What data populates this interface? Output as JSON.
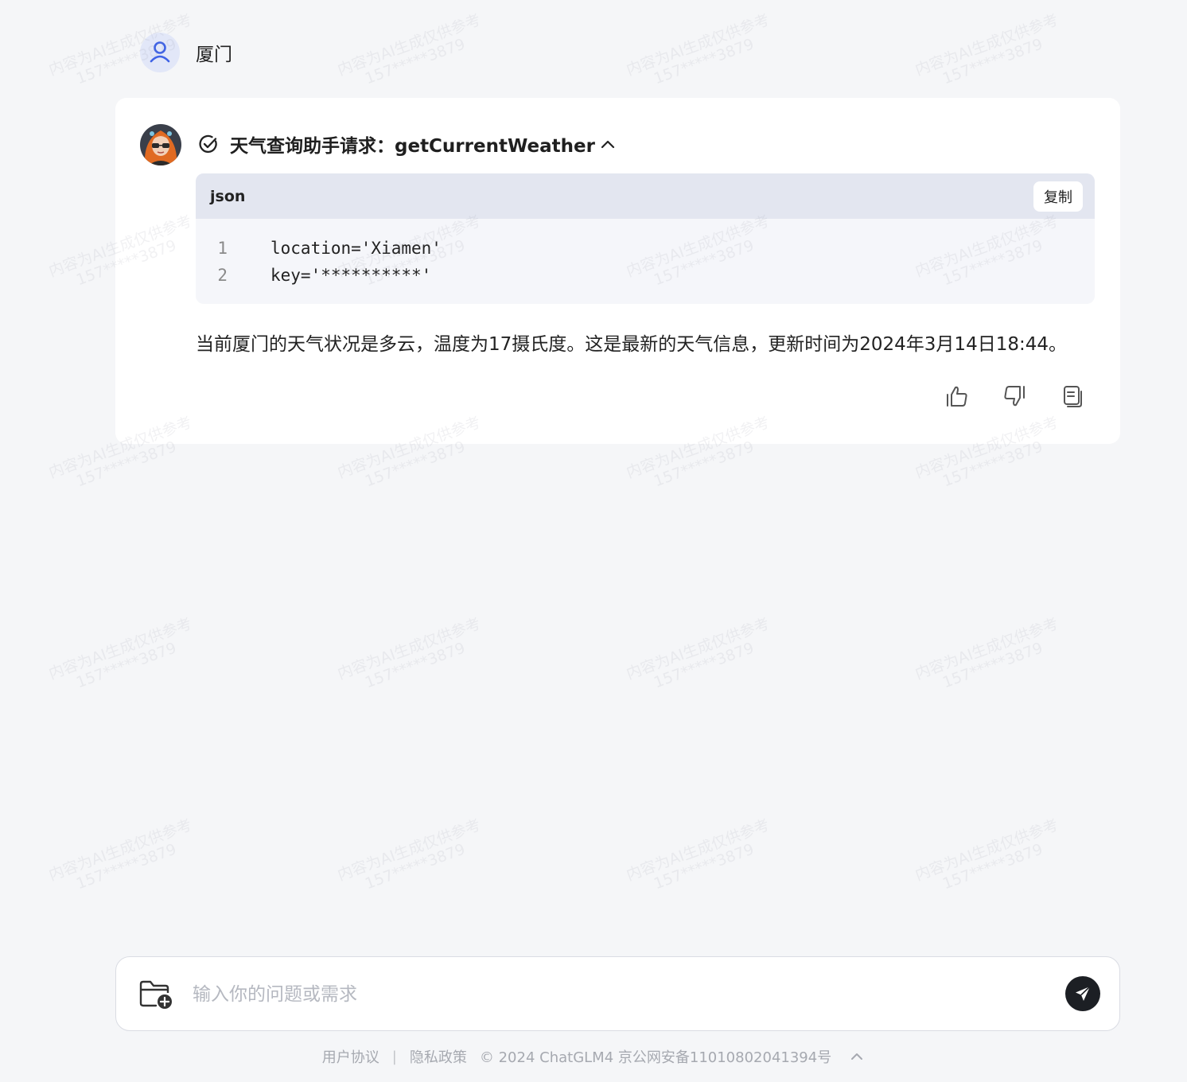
{
  "user_message": {
    "text": "厦门"
  },
  "assistant": {
    "tool_call": {
      "title": "天气查询助手请求：getCurrentWeather",
      "language": "json",
      "copy_label": "复制",
      "lines": [
        {
          "number": "1",
          "code": "location='Xiamen'"
        },
        {
          "number": "2",
          "code": "key='**********'"
        }
      ]
    },
    "answer": "当前厦门的天气状况是多云，温度为17摄氏度。这是最新的天气信息，更新时间为2024年3月14日18:44。",
    "actions": [
      "thumbs-up-icon",
      "thumbs-down-icon",
      "copy-icon"
    ]
  },
  "input": {
    "placeholder": "输入你的问题或需求",
    "value": ""
  },
  "footer": {
    "user_agreement": "用户协议",
    "separator": "|",
    "privacy": "隐私政策",
    "copyright": "© 2024 ChatGLM4 京公网安备11010802041394号"
  },
  "watermark": {
    "line1": "内容为AI生成仅供参考",
    "line2": "157*****3879"
  },
  "colors": {
    "user_avatar_bg": "#e2e7f8",
    "user_icon": "#3f63e6",
    "send_button": "#1c1f24"
  }
}
